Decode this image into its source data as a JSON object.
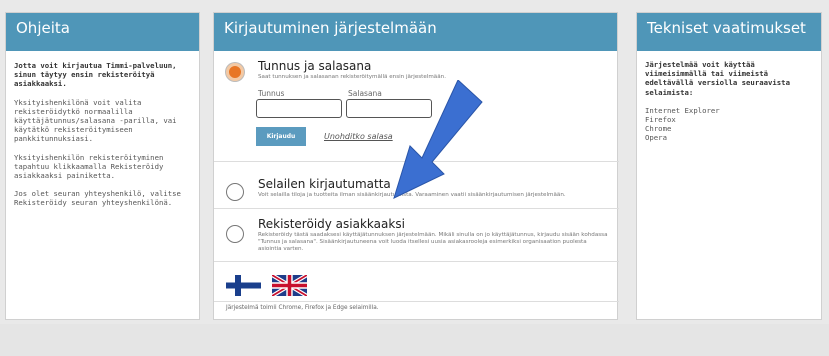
{
  "left": {
    "header": "Ohjeita",
    "intro": "Jotta voit kirjautua Timmi-palveluun, sinun täytyy ensin rekisteröityä asiakkaaksi.",
    "para1": "Yksityishenkilönä voit valita rekisteröidytkö normaalilla käyttäjätunnus/salasana -parilla, vai käytätkö rekisteröitymiseen pankkitunnuksiasi.",
    "para2": "Yksityishenkilön rekisteröityminen tapahtuu klikkaamalla Rekisteröidy asiakkaaksi painiketta.",
    "para3": "Jos olet seuran yhteyshenkilö, valitse Rekisteröidy seuran yhteyshenkilönä."
  },
  "center": {
    "header": "Kirjautuminen järjestelmään",
    "option1": {
      "title": "Tunnus ja salasana",
      "desc": "Saat tunnuksen ja salasanan rekisteröitymällä ensin järjestelmään.",
      "username_label": "Tunnus",
      "password_label": "Salasana",
      "login_button": "Kirjaudu",
      "forgot_link": "Unohditko salasa"
    },
    "option2": {
      "title": "Selailen kirjautumatta",
      "desc": "Voit selailla tiloja ja tuotteita ilman sisäänkirjautumista. Varaaminen vaatii sisäänkirjautumisen järjestelmään."
    },
    "option3": {
      "title": "Rekisteröidy asiakkaaksi",
      "desc": "Rekisteröidy tästä saadaksesi käyttäjätunnuksen järjestelmään. Mikäli sinulla on jo käyttäjätunnus, kirjaudu sisään kohdassa \"Tunnus ja salasana\". Sisäänkirjautuneena voit luoda itsellesi uusia asiakasrooleja esimerkiksi organisaation puolesta asiointia varten."
    },
    "footer": "Järjestelmä toimii Chrome, Firefox ja Edge selaimilla."
  },
  "right": {
    "header": "Tekniset vaatimukset",
    "intro": "Järjestelmää voit käyttää viimeisimmällä tai viimeistä edeltävällä versiolla seuraavista selaimista:",
    "browsers": [
      "Internet Explorer",
      "Firefox",
      "Chrome",
      "Opera"
    ]
  },
  "colors": {
    "header_bg": "#4f96b8",
    "radio_selected": "#e87625",
    "arrow": "#3b6fd1"
  }
}
